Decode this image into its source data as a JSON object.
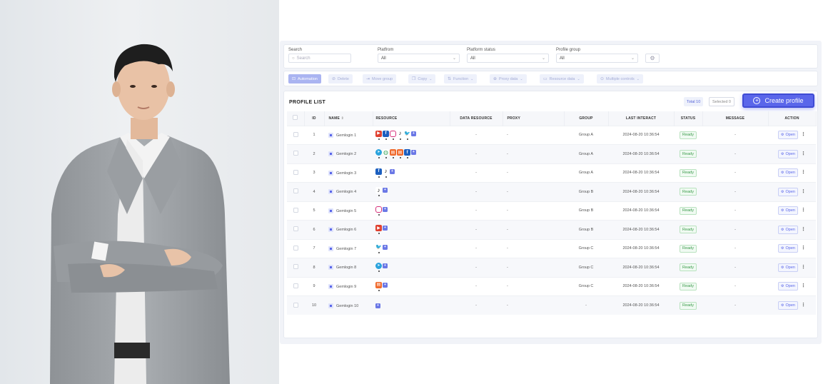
{
  "filters": {
    "search": {
      "label": "Search",
      "placeholder": "Search"
    },
    "platform": {
      "label": "Platfrom",
      "value": "All"
    },
    "platform_status": {
      "label": "Platform status",
      "value": "All"
    },
    "profile_group": {
      "label": "Profile group",
      "value": "All"
    }
  },
  "toolbar": [
    {
      "label": "Automation",
      "icon": "automation-icon",
      "primary": true,
      "dropdown": false
    },
    {
      "label": "Delete",
      "icon": "trash-icon",
      "primary": false,
      "dropdown": false
    },
    {
      "label": "Move group",
      "icon": "move-icon",
      "primary": false,
      "dropdown": false
    },
    {
      "label": "Copy",
      "icon": "copy-icon",
      "primary": false,
      "dropdown": true
    },
    {
      "label": "Function",
      "icon": "function-icon",
      "primary": false,
      "dropdown": true
    },
    {
      "label": "Proxy data",
      "icon": "proxy-icon",
      "primary": false,
      "dropdown": true
    },
    {
      "label": "Resource data",
      "icon": "folder-icon",
      "primary": false,
      "dropdown": true
    },
    {
      "label": "Multiple controls",
      "icon": "controls-icon",
      "primary": false,
      "dropdown": true
    }
  ],
  "list": {
    "title": "PROFILE LIST",
    "total": "Total 10",
    "selected": "Selected 0",
    "create_label": "Create profile"
  },
  "columns": [
    "ID",
    "NAME",
    "RESOURCE",
    "DATA RESOURCE",
    "PROXY",
    "GROUP",
    "LAST INTERACT",
    "STATUS",
    "MESSAGE",
    "ACTION"
  ],
  "colors": {
    "accent": "#5a66ea",
    "ready": "#3a9a4a"
  },
  "rows": [
    {
      "id": "1",
      "name": "Gemlogin 1",
      "resources": [
        "youtube",
        "facebook",
        "instagram",
        "tiktok",
        "twitter"
      ],
      "data_resource": "-",
      "proxy": "-",
      "group": "Group A",
      "last_interact": "2024-08-20 10:36:54",
      "status": "Ready",
      "message": "-",
      "action": "Open"
    },
    {
      "id": "2",
      "name": "Gemlogin 2",
      "resources": [
        "telegram",
        "globe",
        "shopee",
        "shopee",
        "facebook"
      ],
      "data_resource": "-",
      "proxy": "-",
      "group": "Group A",
      "last_interact": "2024-08-20 10:36:54",
      "status": "Ready",
      "message": "-",
      "action": "Open"
    },
    {
      "id": "3",
      "name": "Gemlogin 3",
      "resources": [
        "facebook",
        "tiktok"
      ],
      "data_resource": "-",
      "proxy": "-",
      "group": "Group A",
      "last_interact": "2024-08-20 10:36:54",
      "status": "Ready",
      "message": "-",
      "action": "Open"
    },
    {
      "id": "4",
      "name": "Gemlogin 4",
      "resources": [
        "tiktok"
      ],
      "data_resource": "-",
      "proxy": "-",
      "group": "Group B",
      "last_interact": "2024-08-20 10:36:54",
      "status": "Ready",
      "message": "-",
      "action": "Open"
    },
    {
      "id": "5",
      "name": "Gemlogin 5",
      "resources": [
        "instagram"
      ],
      "data_resource": "-",
      "proxy": "-",
      "group": "Group B",
      "last_interact": "2024-08-20 10:36:54",
      "status": "Ready",
      "message": "-",
      "action": "Open"
    },
    {
      "id": "6",
      "name": "Gemlogin 6",
      "resources": [
        "youtube"
      ],
      "data_resource": "-",
      "proxy": "-",
      "group": "Group B",
      "last_interact": "2024-08-20 10:36:54",
      "status": "Ready",
      "message": "-",
      "action": "Open"
    },
    {
      "id": "7",
      "name": "Gemlogin 7",
      "resources": [
        "twitter"
      ],
      "data_resource": "-",
      "proxy": "-",
      "group": "Group C",
      "last_interact": "2024-08-20 10:36:54",
      "status": "Ready",
      "message": "-",
      "action": "Open"
    },
    {
      "id": "8",
      "name": "Gemlogin 8",
      "resources": [
        "telegram"
      ],
      "data_resource": "-",
      "proxy": "-",
      "group": "Group C",
      "last_interact": "2024-08-20 10:36:54",
      "status": "Ready",
      "message": "-",
      "action": "Open"
    },
    {
      "id": "9",
      "name": "Gemlogin 9",
      "resources": [
        "shopee"
      ],
      "data_resource": "-",
      "proxy": "-",
      "group": "Group C",
      "last_interact": "2024-08-20 10:36:54",
      "status": "Ready",
      "message": "-",
      "action": "Open"
    },
    {
      "id": "10",
      "name": "Gemlogin 10",
      "resources": [],
      "data_resource": "-",
      "proxy": "-",
      "group": "-",
      "last_interact": "2024-08-20 10:36:54",
      "status": "Ready",
      "message": "-",
      "action": "Open"
    }
  ]
}
